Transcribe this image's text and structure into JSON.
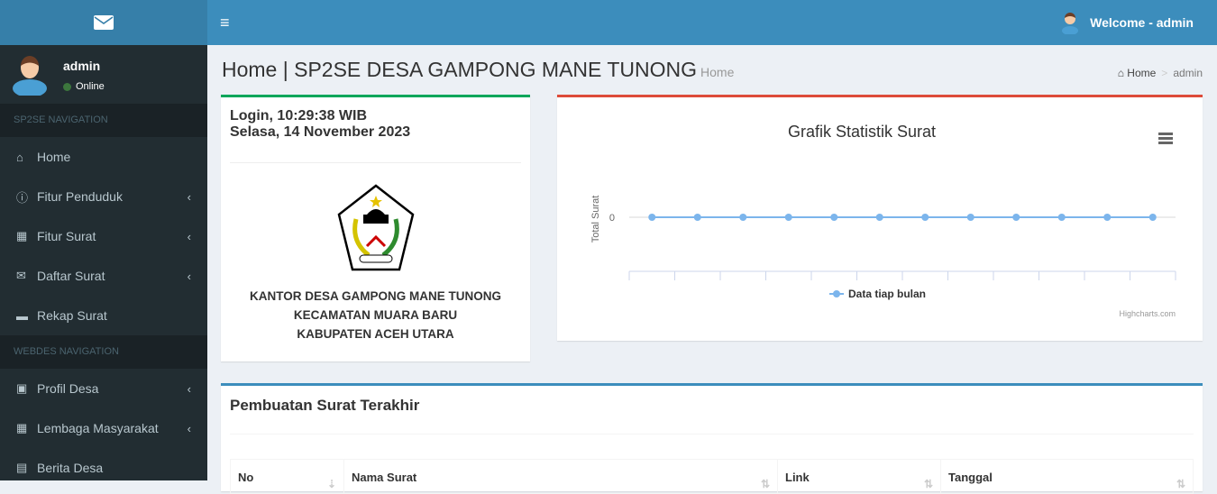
{
  "header": {
    "welcome": "Welcome - admin",
    "menu_icon": "hamburger-icon",
    "logo_icon": "envelope-icon"
  },
  "user": {
    "name": "admin",
    "status": "Online",
    "status_color": "#3c763d"
  },
  "sidebar": {
    "section1": "SP2SE NAVIGATION",
    "items1": [
      {
        "label": "Home",
        "icon": "home"
      },
      {
        "label": "Fitur Penduduk",
        "icon": "info"
      },
      {
        "label": "Fitur Surat",
        "icon": "table"
      },
      {
        "label": "Daftar Surat",
        "icon": "envelope"
      },
      {
        "label": "Rekap Surat",
        "icon": "archive"
      }
    ],
    "section2": "WEBDES NAVIGATION",
    "items2": [
      {
        "label": "Profil Desa",
        "icon": "contact"
      },
      {
        "label": "Lembaga Masyarakat",
        "icon": "table"
      },
      {
        "label": "Berita Desa",
        "icon": "newspaper"
      }
    ]
  },
  "page": {
    "title": "Home | SP2SE DESA GAMPONG MANE TUNONG",
    "subtitle": "Home",
    "breadcrumb": [
      "Home",
      "admin"
    ]
  },
  "login_box": {
    "time": "Login, 10:29:38 WIB",
    "date": "Selasa, 14 November 2023",
    "logo_text": "ACEH UTARA",
    "office": [
      "KANTOR DESA GAMPONG MANE TUNONG",
      "KECAMATAN MUARA BARU",
      "KABUPATEN ACEH UTARA"
    ]
  },
  "chart_data": {
    "type": "line",
    "title": "Grafik Statistik Surat",
    "ylabel": "Total Surat",
    "yticks": [
      "0"
    ],
    "categories": [
      "",
      "",
      "",
      "",
      "",
      "",
      "",
      "",
      "",
      "",
      "",
      ""
    ],
    "series": [
      {
        "name": "Data tiap bulan",
        "values": [
          0,
          0,
          0,
          0,
          0,
          0,
          0,
          0,
          0,
          0,
          0,
          0
        ],
        "color": "#7cb5ec"
      }
    ],
    "credits": "Highcharts.com",
    "legend": "bottom",
    "grid": true
  },
  "recent": {
    "title": "Pembuatan Surat Terakhir",
    "columns": [
      "No",
      "Nama Surat",
      "Link",
      "Tanggal"
    ]
  }
}
